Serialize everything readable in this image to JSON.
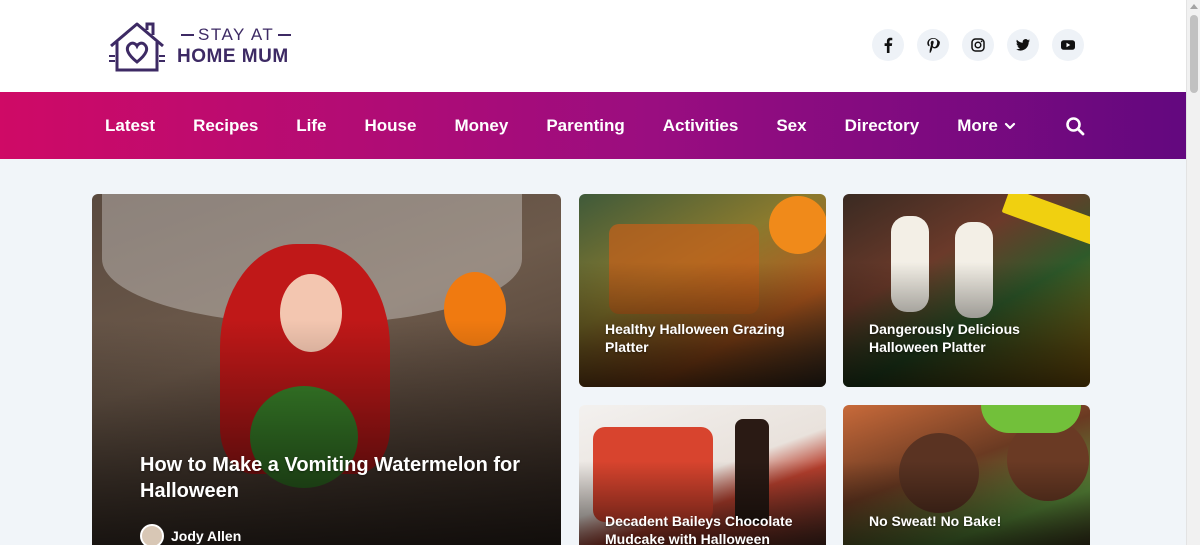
{
  "site": {
    "logo_line1": "STAY AT",
    "logo_line2": "HOME MUM"
  },
  "socials": [
    {
      "icon": "facebook-icon"
    },
    {
      "icon": "pinterest-icon"
    },
    {
      "icon": "instagram-icon"
    },
    {
      "icon": "twitter-icon"
    },
    {
      "icon": "youtube-icon"
    }
  ],
  "nav": {
    "items": [
      "Latest",
      "Recipes",
      "Life",
      "House",
      "Money",
      "Parenting",
      "Activities",
      "Sex",
      "Directory"
    ],
    "more_label": "More",
    "search_icon": "search-icon"
  },
  "colors": {
    "brand_purple": "#3d2a64",
    "nav_gradient_start": "#cf0a66",
    "nav_gradient_end": "#63087f"
  },
  "featured": {
    "title": "How to Make a Vomiting Watermelon for Halloween",
    "author": "Jody Allen"
  },
  "cards": [
    {
      "title": "Healthy Halloween Grazing Platter"
    },
    {
      "title": "Dangerously Delicious Halloween Platter"
    },
    {
      "title": "Decadent Baileys Chocolate Mudcake with Halloween"
    },
    {
      "title": "No Sweat! No Bake!"
    }
  ]
}
